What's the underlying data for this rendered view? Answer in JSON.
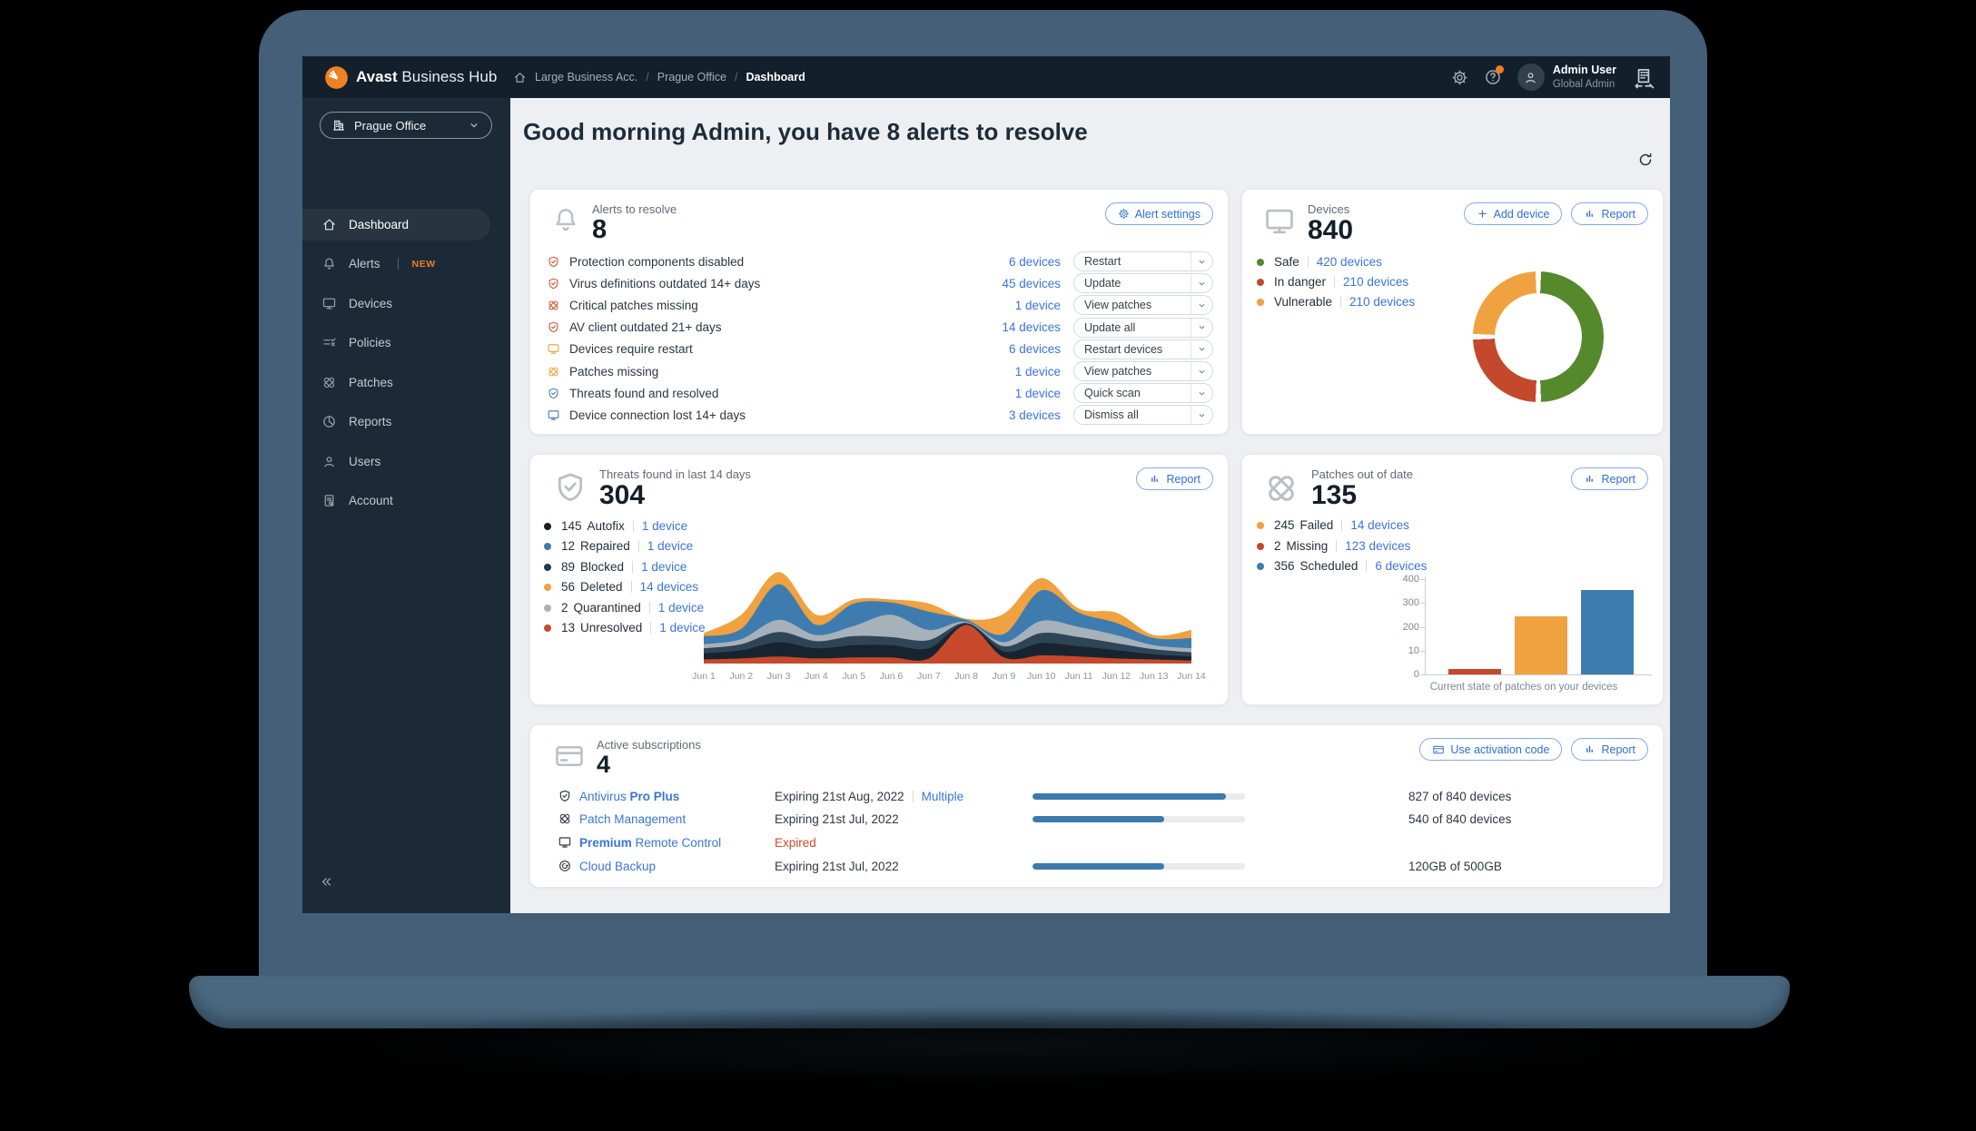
{
  "topbar": {
    "brand_bold": "Avast",
    "brand_rest": "Business Hub",
    "breadcrumb": [
      "Large Business Acc.",
      "Prague Office",
      "Dashboard"
    ],
    "user": {
      "name": "Admin User",
      "role": "Global Admin"
    }
  },
  "sidebar": {
    "org_selector": "Prague Office",
    "items": [
      {
        "label": "Dashboard",
        "icon": "home",
        "active": true
      },
      {
        "label": "Alerts",
        "icon": "bell",
        "badge": "NEW"
      },
      {
        "label": "Devices",
        "icon": "monitor"
      },
      {
        "label": "Policies",
        "icon": "policies"
      },
      {
        "label": "Patches",
        "icon": "patch"
      },
      {
        "label": "Reports",
        "icon": "pie"
      },
      {
        "label": "Users",
        "icon": "user"
      },
      {
        "label": "Account",
        "icon": "doc"
      }
    ]
  },
  "page": {
    "greeting": "Good morning Admin, you have 8 alerts to resolve"
  },
  "alerts": {
    "title": "Alerts to resolve",
    "count": "8",
    "settings_label": "Alert settings",
    "rows": [
      {
        "label": "Protection components disabled",
        "devices": "6 devices",
        "action": "Restart",
        "icon": "shield-check",
        "color": "#cf4b2d"
      },
      {
        "label": "Virus definitions outdated 14+ days",
        "devices": "45 devices",
        "action": "Update",
        "icon": "shield-check",
        "color": "#cf4b2d"
      },
      {
        "label": "Critical patches missing",
        "devices": "1 device",
        "action": "View patches",
        "icon": "patch",
        "color": "#cf4b2d"
      },
      {
        "label": "AV client outdated 21+ days",
        "devices": "14 devices",
        "action": "Update all",
        "icon": "shield-check",
        "color": "#cf4b2d"
      },
      {
        "label": "Devices require restart",
        "devices": "6 devices",
        "action": "Restart devices",
        "icon": "monitor",
        "color": "#ef9f3c"
      },
      {
        "label": "Patches missing",
        "devices": "1 device",
        "action": "View patches",
        "icon": "patch",
        "color": "#ef9f3c"
      },
      {
        "label": "Threats found and resolved",
        "devices": "1 device",
        "action": "Quick scan",
        "icon": "shield-check",
        "color": "#4178ae"
      },
      {
        "label": "Device connection lost 14+ days",
        "devices": "3 devices",
        "action": "Dismiss all",
        "icon": "monitor",
        "color": "#4178ae"
      }
    ]
  },
  "devices": {
    "title": "Devices",
    "count": "840",
    "add_label": "Add device",
    "report_label": "Report",
    "legend": [
      {
        "label": "Safe",
        "link": "420 devices",
        "color": "#56892c"
      },
      {
        "label": "In danger",
        "link": "210 devices",
        "color": "#c4492c"
      },
      {
        "label": "Vulnerable",
        "link": "210 devices",
        "color": "#efa23f"
      }
    ],
    "chart_data": {
      "type": "pie",
      "slices": [
        {
          "label": "Safe",
          "value": 420,
          "color": "#56892c"
        },
        {
          "label": "In danger",
          "value": 210,
          "color": "#c4492c"
        },
        {
          "label": "Vulnerable",
          "value": 210,
          "color": "#efa23f"
        }
      ],
      "total": 840
    }
  },
  "threats": {
    "title": "Threats found in last 14 days",
    "count": "304",
    "report_label": "Report",
    "legend": [
      {
        "count": "145",
        "label": "Autofix",
        "link": "1 device",
        "color": "#141f2a"
      },
      {
        "count": "12",
        "label": "Repaired",
        "link": "1 device",
        "color": "#3e7cb0"
      },
      {
        "count": "89",
        "label": "Blocked",
        "link": "1 device",
        "color": "#253a4d"
      },
      {
        "count": "56",
        "label": "Deleted",
        "link": "14 devices",
        "color": "#efa23f"
      },
      {
        "count": "2",
        "label": "Quarantined",
        "link": "1 device",
        "color": "#a9b2ba"
      },
      {
        "count": "13",
        "label": "Unresolved",
        "link": "1 device",
        "color": "#c4492c"
      }
    ],
    "chart_data": {
      "type": "area",
      "stacked": true,
      "x": [
        "Jun 1",
        "Jun 2",
        "Jun 3",
        "Jun 4",
        "Jun 5",
        "Jun 6",
        "Jun 7",
        "Jun 8",
        "Jun 9",
        "Jun 10",
        "Jun 11",
        "Jun 12",
        "Jun 13",
        "Jun 14"
      ],
      "series": [
        {
          "name": "Unresolved",
          "color": "#c5492a",
          "values": [
            4,
            5,
            7,
            5,
            6,
            6,
            5,
            38,
            6,
            8,
            7,
            5,
            4,
            3
          ]
        },
        {
          "name": "Autofix",
          "color": "#17242f",
          "values": [
            6,
            8,
            14,
            10,
            12,
            12,
            10,
            1,
            6,
            12,
            10,
            8,
            5,
            4
          ]
        },
        {
          "name": "Blocked",
          "color": "#2e4557",
          "values": [
            5,
            6,
            10,
            7,
            9,
            8,
            8,
            1,
            5,
            10,
            9,
            7,
            5,
            4
          ]
        },
        {
          "name": "Quarantined",
          "color": "#a7b1b9",
          "values": [
            4,
            5,
            12,
            6,
            10,
            22,
            10,
            1,
            4,
            12,
            10,
            8,
            4,
            4
          ]
        },
        {
          "name": "Repaired",
          "color": "#3e7cb0",
          "values": [
            8,
            10,
            35,
            10,
            22,
            12,
            18,
            2,
            8,
            30,
            14,
            12,
            7,
            10
          ]
        },
        {
          "name": "Deleted",
          "color": "#efa23f",
          "values": [
            3,
            14,
            12,
            10,
            4,
            3,
            8,
            1,
            20,
            12,
            4,
            10,
            3,
            8
          ]
        }
      ]
    }
  },
  "patches": {
    "title": "Patches out of date",
    "count": "135",
    "report_label": "Report",
    "legend": [
      {
        "count": "245",
        "label": "Failed",
        "link": "14 devices",
        "color": "#efa23f"
      },
      {
        "count": "2",
        "label": "Missing",
        "link": "123 devices",
        "color": "#c4492c"
      },
      {
        "count": "356",
        "label": "Scheduled",
        "link": "6 devices",
        "color": "#3e7cb0"
      }
    ],
    "chart_data": {
      "type": "bar",
      "categories": [
        "Missing",
        "Failed",
        "Scheduled"
      ],
      "values": [
        2,
        245,
        356
      ],
      "colors": [
        "#c4492c",
        "#efa23f",
        "#3e7cb0"
      ],
      "ylim": [
        0,
        400
      ],
      "yticks": [
        {
          "label": "400",
          "frac": 1
        },
        {
          "label": "300",
          "frac": 0.75
        },
        {
          "label": "200",
          "frac": 0.5
        },
        {
          "label": "10",
          "frac": 0.25
        },
        {
          "label": "0",
          "frac": 0
        }
      ],
      "caption": "Current state of patches on your devices"
    }
  },
  "subscriptions": {
    "title": "Active subscriptions",
    "count": "4",
    "activation_label": "Use activation code",
    "report_label": "Report",
    "rows": [
      {
        "icon": "shield-check",
        "name_pre": "Antivirus ",
        "name_bold": "Pro Plus",
        "name_suf": "",
        "expiry": "Expiring 21st Aug, 2022",
        "extra_link": "Multiple",
        "expired": false,
        "progress": 91,
        "usage": "827 of 840 devices"
      },
      {
        "icon": "patch",
        "name_pre": "Patch Management",
        "name_bold": "",
        "name_suf": "",
        "expiry": "Expiring 21st Jul, 2022",
        "extra_link": "",
        "expired": false,
        "progress": 62,
        "usage": "540 of 840 devices"
      },
      {
        "icon": "monitor",
        "name_pre": "",
        "name_bold": "Premium",
        "name_suf": " Remote Control",
        "expiry": "Expired",
        "extra_link": "",
        "expired": true,
        "progress": null,
        "usage": ""
      },
      {
        "icon": "cloud",
        "name_pre": "Cloud Backup",
        "name_bold": "",
        "name_suf": "",
        "expiry": "Expiring 21st Jul, 2022",
        "extra_link": "",
        "expired": false,
        "progress": 62,
        "usage": "120GB of 500GB"
      }
    ]
  },
  "colors": {
    "accent_blue": "#3b74dd",
    "green": "#56892c",
    "red": "#c4492c",
    "orange": "#efa23f",
    "steel_blue": "#3e7cb0",
    "dark_navy": "#141f2a",
    "badge_orange": "#ef7d24"
  }
}
